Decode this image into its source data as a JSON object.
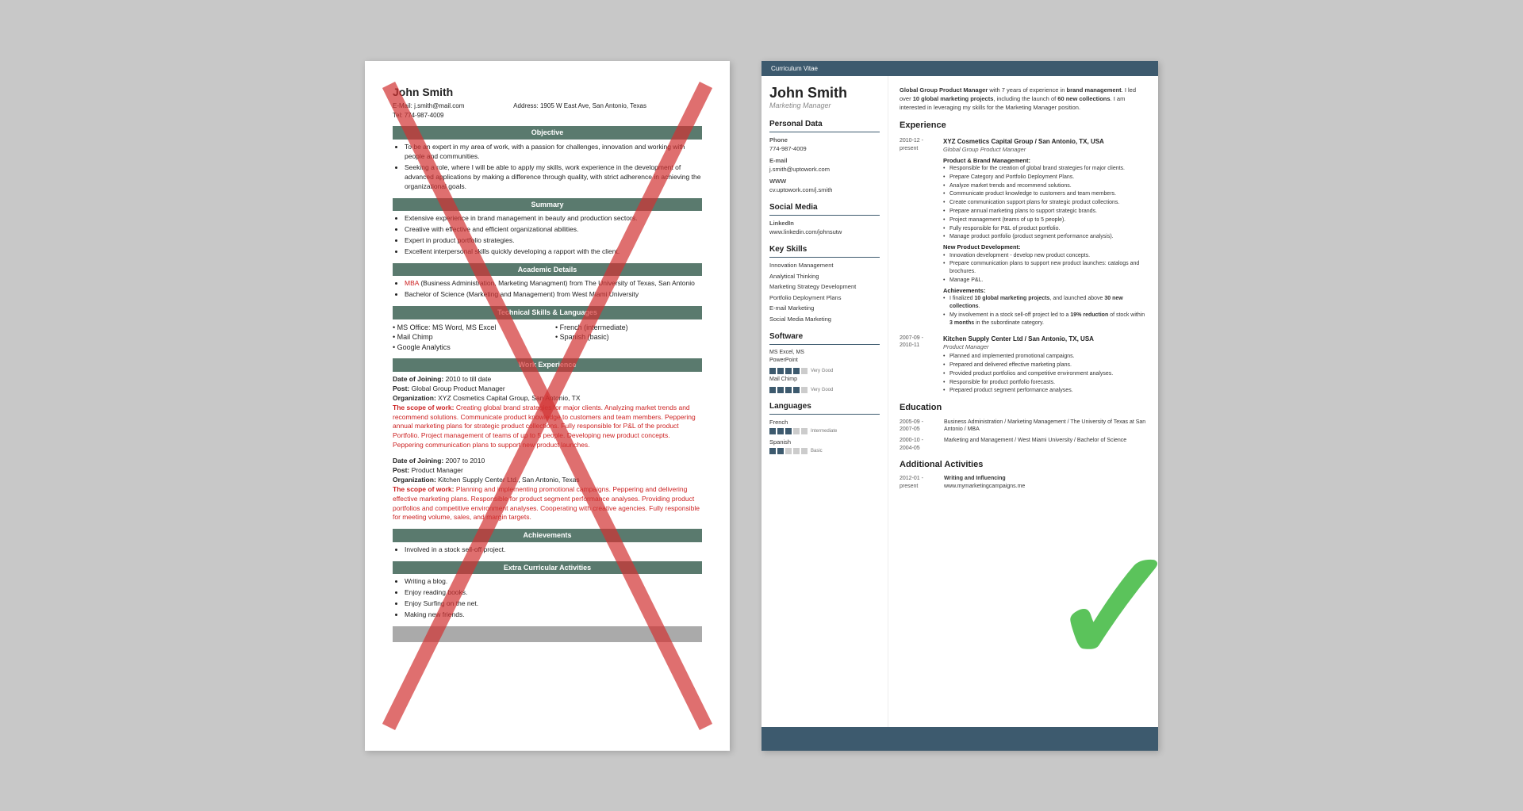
{
  "left_resume": {
    "name": "John Smith",
    "email_label": "E-Mail:",
    "email": "j.smith@mail.com",
    "address_label": "Address:",
    "address": "1905 W East Ave, San Antonio, Texas",
    "tel_label": "Tel:",
    "tel": "774-987-4009",
    "sections": {
      "objective": {
        "title": "Objective",
        "bullets": [
          "To be an expert in my area of work, with a passion for challenges, innovation and working with people and communities.",
          "Seeking a role, where I will be able to apply my skills, work experience in the development of advanced applications by making a difference through quality, with strict adherence in achieving the organizational goals."
        ]
      },
      "summary": {
        "title": "Summary",
        "bullets": [
          "Extensive experience in brand management in beauty and production sectors.",
          "Creative with effective and efficient organizational abilities.",
          "Expert in product portfolio strategies.",
          "Excellent interpersonal skills quickly developing a rapport with the client."
        ]
      },
      "academic": {
        "title": "Academic Details",
        "bullets": [
          "MBA (Business Administration, Marketing Managment) from The University of Texas, San Antonio",
          "Bachelor of Science (Marketing and Management) from West Miami University"
        ]
      },
      "technical": {
        "title": "Technical Skills & Languages",
        "ms_office": "MS Office: MS Word, MS Excel",
        "mail_chimp": "Mail Chimp",
        "google_analytics": "Google Analytics",
        "french": "French (intermediate)",
        "spanish": "Spanish (basic)"
      },
      "work_experience": {
        "title": "Work Experience",
        "entries": [
          {
            "date_label": "Date of Joining:",
            "date": "2010 to till date",
            "post_label": "Post:",
            "post": "Global Group Product Manager",
            "org_label": "Organization:",
            "org": "XYZ Cosmetics Capital Group, San Antonio, TX",
            "scope_label": "The scope of work:",
            "scope": "Creating global brand strategies for major clients. Analyzing market trends and recommend solutions. Communicate product knowledge to customers and team members. Peppering annual marketing plans for strategic product collections. Fully responsible for P&L of the product Portfolio. Project management of teams of up to 5 people. Developing new product concepts. Peppering communication plans to support new product launches."
          },
          {
            "date_label": "Date of Joining:",
            "date": "2007 to 2010",
            "post_label": "Post:",
            "post": "Product Manager",
            "org_label": "Organization:",
            "org": "Kitchen Supply Center Ltd., San Antonio, Texas",
            "scope_label": "The scope of work:",
            "scope": "Planning and implementing promotional campaigns. Peppering and delivering effective marketing plans. Responsible for product segment performance analyses. Providing product portfolios and competitive environment analyses. Cooperating with creative agencies. Fully responsible for meeting volume, sales, and margin targets."
          }
        ]
      },
      "achievements": {
        "title": "Achievements",
        "bullets": [
          "Involved in a stock sell-off project."
        ]
      },
      "extra": {
        "title": "Extra Curricular Activities",
        "bullets": [
          "Writing a blog.",
          "Enjoy reading books.",
          "Enjoy Surfing on the net.",
          "Making new friends."
        ]
      }
    }
  },
  "right_resume": {
    "cv_label": "Curriculum Vitae",
    "name": "John Smith",
    "title": "Marketing Manager",
    "summary": "Global Group Product Manager with 7 years of experience in brand management. I led over 10 global marketing projects, including the launch of 60 new collections. I am interested in leveraging my skills for the Marketing Manager position.",
    "personal_data": {
      "section_title": "Personal Data",
      "phone_label": "Phone",
      "phone": "774-987-4009",
      "email_label": "E-mail",
      "email": "j.smith@uptowork.com",
      "www_label": "WWW",
      "www": "cv.uptowork.com/j.smith",
      "social_label": "Social Media",
      "linkedin_label": "LinkedIn",
      "linkedin": "www.linkedin.com/johnsutw"
    },
    "key_skills": {
      "section_title": "Key Skills",
      "items": [
        "Innovation Management",
        "Analytical Thinking",
        "Marketing Strategy Development",
        "Portfolio Deployment Plans",
        "E-mail Marketing",
        "Social Media Marketing"
      ]
    },
    "software": {
      "section_title": "Software",
      "items": [
        {
          "name": "MS Excel, MS PowerPoint",
          "filled": 4,
          "total": 5,
          "level": "Very Good"
        },
        {
          "name": "Mail Chimp",
          "filled": 4,
          "total": 5,
          "level": "Very Good"
        }
      ]
    },
    "languages": {
      "section_title": "Languages",
      "items": [
        {
          "name": "French",
          "filled": 3,
          "total": 5,
          "level": "Intermediate"
        },
        {
          "name": "Spanish",
          "filled": 2,
          "total": 5,
          "level": "Basic"
        }
      ]
    },
    "experience": {
      "section_title": "Experience",
      "entries": [
        {
          "dates": "2010-12 - present",
          "company": "XYZ Cosmetics Capital Group / San Antonio, TX, USA",
          "post": "Global Group Product Manager",
          "sub_sections": [
            {
              "head": "Product & Brand Management:",
              "bullets": [
                "Responsible for the creation of global brand strategies for major clients.",
                "Prepare Category and Portfolio Deployment Plans.",
                "Analyze market trends and recommend solutions.",
                "Communicate product knowledge to customers and team members.",
                "Create communication support plans for strategic product collections.",
                "Prepare annual marketing plans to support strategic brands.",
                "Project management (teams of up to 5 people).",
                "Fully responsible for P&L of product portfolio.",
                "Manage product portfolio (product segment performance analysis)."
              ]
            },
            {
              "head": "New Product Development:",
              "bullets": [
                "Innovation development - develop new product concepts.",
                "Prepare communication plans to support new product launches: catalogs and brochures.",
                "Manage P&L."
              ]
            },
            {
              "head": "Achievements:",
              "bullets": [
                "I finalized 10 global marketing projects, and launched above 30 new collections.",
                "My involvement in a stock sell-off project led to a 19% reduction of stock within 3 months in the subordinate category."
              ]
            }
          ]
        },
        {
          "dates": "2007-09 - 2010-11",
          "company": "Kitchen Supply Center Ltd / San Antonio, TX, USA",
          "post": "Product Manager",
          "bullets": [
            "Planned and implemented promotional campaigns.",
            "Prepared and delivered effective marketing plans.",
            "Provided product portfolios and competitive environment analyses.",
            "Responsible for product portfolio forecasts.",
            "Prepared product segment performance analyses."
          ]
        }
      ]
    },
    "education": {
      "section_title": "Education",
      "entries": [
        {
          "dates": "2005-09 - 2007-05",
          "text": "Business Administration / Marketing Management / The University of Texas at San Antonio / MBA"
        },
        {
          "dates": "2000-10 - 2004-05",
          "text": "Marketing and Management / West Miami University / Bachelor of Science"
        }
      ]
    },
    "additional_activities": {
      "section_title": "Additional Activities",
      "entries": [
        {
          "dates": "2012-01 - present",
          "title": "Writing and Influencing",
          "detail": "www.mymarketingcampaigns.me"
        }
      ]
    }
  }
}
